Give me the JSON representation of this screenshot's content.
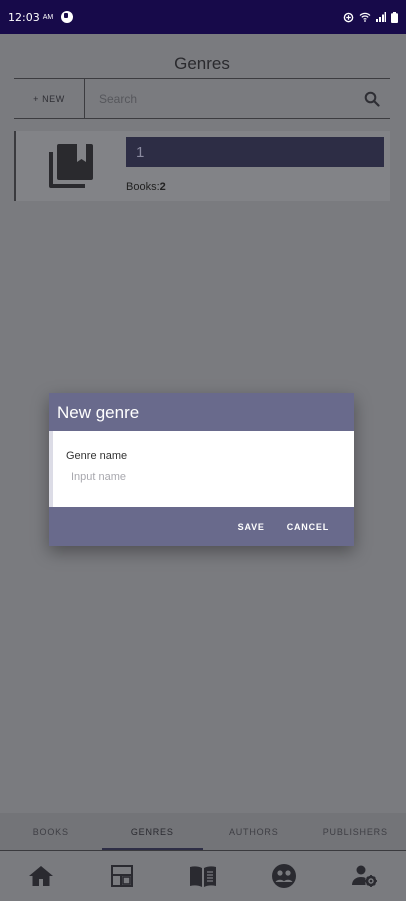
{
  "status_bar": {
    "time": "12:03",
    "ampm": "AM"
  },
  "page": {
    "title": "Genres",
    "new_button_label": "+ NEW",
    "search_placeholder": "Search"
  },
  "genres": [
    {
      "name": "1",
      "books_label": "Books:",
      "books_count": "2"
    }
  ],
  "dialog": {
    "title": "New genre",
    "field_label": "Genre name",
    "input_value": "",
    "input_placeholder": "Input name",
    "save_label": "SAVE",
    "cancel_label": "CANCEL"
  },
  "tabs": [
    {
      "label": "BOOKS",
      "active": false
    },
    {
      "label": "GENRES",
      "active": true
    },
    {
      "label": "AUTHORS",
      "active": false
    },
    {
      "label": "PUBLISHERS",
      "active": false
    }
  ],
  "bottom_nav": [
    {
      "icon": "home-icon"
    },
    {
      "icon": "dashboard-icon"
    },
    {
      "icon": "book-open-icon"
    },
    {
      "icon": "group-icon"
    },
    {
      "icon": "user-settings-icon"
    }
  ],
  "colors": {
    "status_bar": "#170a4a",
    "dialog_accent": "#696a8c",
    "overlay_bg": "#7a7b7f"
  }
}
